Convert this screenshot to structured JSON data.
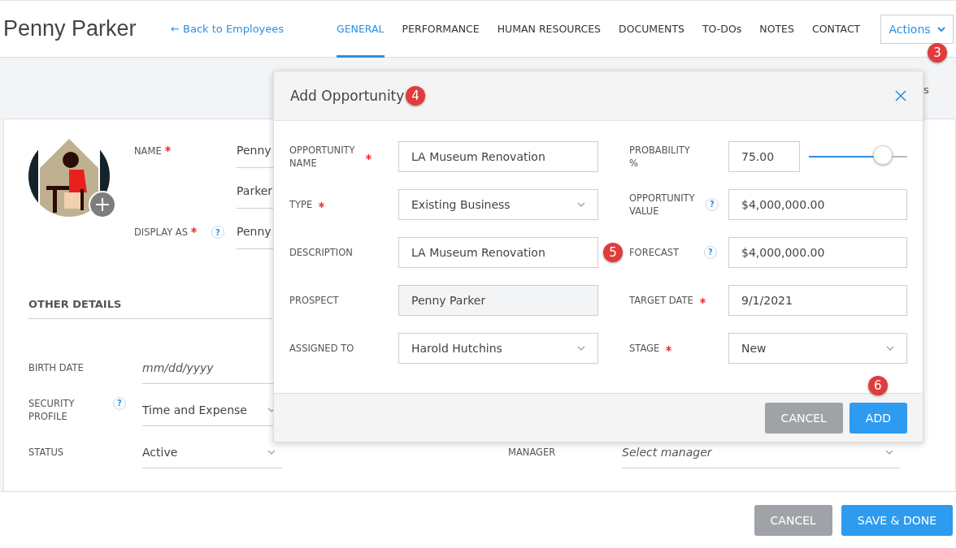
{
  "header": {
    "title": "Penny Parker",
    "back_link": "← Back to Employees",
    "tabs": [
      {
        "label": "GENERAL",
        "selected": true
      },
      {
        "label": "PERFORMANCE",
        "selected": false
      },
      {
        "label": "HUMAN RESOURCES",
        "selected": false
      },
      {
        "label": "DOCUMENTS",
        "selected": false
      },
      {
        "label": "TO-DOs",
        "selected": false
      },
      {
        "label": "NOTES",
        "selected": false
      },
      {
        "label": "CONTACT",
        "selected": false
      }
    ],
    "actions": {
      "label": "Actions",
      "callout": "3"
    }
  },
  "partial_text": "s",
  "profile": {
    "name_label": "NAME",
    "name_required": true,
    "first_name": "Penny",
    "last_name": "Parker",
    "display_label": "DISPLAY AS",
    "display_required": true,
    "display_help": "?",
    "display_value": "Penny"
  },
  "other_details": {
    "heading": "OTHER DETAILS",
    "rows": [
      {
        "label": "BIRTH DATE",
        "kind": "date",
        "placeholder": "mm/dd/yyyy"
      },
      {
        "label": "SECURITY PROFILE",
        "kind": "select",
        "help": "?",
        "value": "Time and Expense"
      },
      {
        "label": "STATUS",
        "kind": "select",
        "value": "Active"
      }
    ],
    "manager": {
      "label": "MANAGER",
      "placeholder": "Select manager"
    }
  },
  "footer": {
    "buttons": [
      {
        "label": "CANCEL",
        "kind": "secondary"
      },
      {
        "label": "SAVE & DONE",
        "kind": "primary"
      }
    ]
  },
  "modal": {
    "title": "Add Opportunity",
    "callout": "4",
    "left_fields": [
      {
        "label": "OPPORTUNITY NAME",
        "required": true,
        "kind": "text",
        "value": "LA Museum Renovation"
      },
      {
        "label": "TYPE",
        "required": true,
        "kind": "select",
        "value": "Existing Business"
      },
      {
        "label": "DESCRIPTION",
        "required": false,
        "kind": "text",
        "value": "LA Museum Renovation",
        "callout": "5"
      },
      {
        "label": "PROSPECT",
        "required": false,
        "kind": "readonly",
        "value": "Penny Parker"
      },
      {
        "label": "ASSIGNED TO",
        "required": false,
        "kind": "select",
        "value": "Harold Hutchins"
      }
    ],
    "right_fields": [
      {
        "label": "PROBABILITY %",
        "required": false,
        "kind": "slider",
        "value": "75.00",
        "level": 0.75
      },
      {
        "label": "OPPORTUNITY VALUE",
        "required": false,
        "help": "?",
        "kind": "text",
        "value": "$4,000,000.00"
      },
      {
        "label": "FORECAST",
        "required": false,
        "help": "?",
        "kind": "text",
        "value": "$4,000,000.00"
      },
      {
        "label": "TARGET DATE",
        "required": true,
        "kind": "text",
        "value": "9/1/2021"
      },
      {
        "label": "STAGE",
        "required": true,
        "kind": "select",
        "value": "New"
      }
    ],
    "buttons": [
      {
        "label": "CANCEL",
        "kind": "secondary"
      },
      {
        "label": "ADD",
        "kind": "primary",
        "callout": "6"
      }
    ]
  }
}
